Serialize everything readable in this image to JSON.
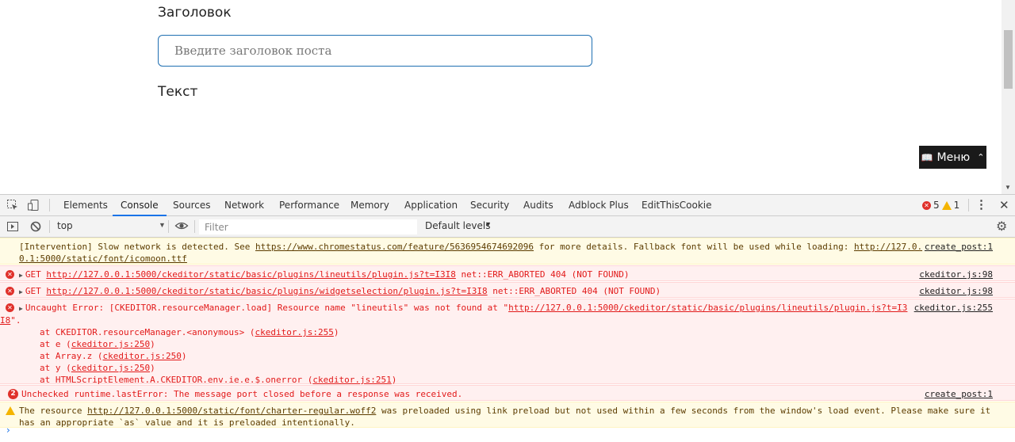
{
  "page": {
    "title_label": "Заголовок",
    "title_placeholder": "Введите заголовок поста",
    "text_label": "Текст",
    "menu_button": "Меню",
    "menu_icon": "book-icon"
  },
  "devtools": {
    "tabs": [
      "Elements",
      "Console",
      "Sources",
      "Network",
      "Performance",
      "Memory",
      "Application",
      "Security",
      "Audits",
      "Adblock Plus",
      "EditThisCookie"
    ],
    "active_tab": "Console",
    "error_count": "5",
    "warning_count": "1",
    "context": "top",
    "filter_placeholder": "Filter",
    "levels": "Default levels"
  },
  "console": {
    "messages": [
      {
        "type": "warning",
        "text_before": "[Intervention] Slow network is detected. See ",
        "link1": "https://www.chromestatus.com/feature/5636954674692096",
        "text_mid": " for more details. Fallback font will be used while loading: ",
        "link2": "http://127.0.",
        "link2_cont": "0.1:5000/static/font/icomoon.ttf",
        "source": "create_post:1"
      },
      {
        "type": "error",
        "method": "GET",
        "url": "http://127.0.0.1:5000/ckeditor/static/basic/plugins/lineutils/plugin.js?t=I3I8",
        "status": " net::ERR_ABORTED 404 (NOT FOUND)",
        "source": "ckeditor.js:98"
      },
      {
        "type": "error",
        "method": "GET",
        "url": "http://127.0.0.1:5000/ckeditor/static/basic/plugins/widgetselection/plugin.js?t=I3I8",
        "status": " net::ERR_ABORTED 404 (NOT FOUND)",
        "source": "ckeditor.js:98"
      },
      {
        "type": "error",
        "text": "Uncaught Error: [CKEDITOR.resourceManager.load] Resource name \"lineutils\" was not found at \"",
        "url": "http://127.0.0.1:5000/ckeditor/static/basic/plugins/lineutils/plugin.js?t=I3",
        "url_cont": "I8",
        "tail": "\".",
        "source": "ckeditor.js:255",
        "stack": [
          {
            "pre": "at CKEDITOR.resourceManager.<anonymous> (",
            "link": "ckeditor.js:255",
            "post": ")"
          },
          {
            "pre": "at e (",
            "link": "ckeditor.js:250",
            "post": ")"
          },
          {
            "pre": "at Array.z (",
            "link": "ckeditor.js:250",
            "post": ")"
          },
          {
            "pre": "at y (",
            "link": "ckeditor.js:250",
            "post": ")"
          },
          {
            "pre": "at HTMLScriptElement.A.CKEDITOR.env.ie.e.$.onerror (",
            "link": "ckeditor.js:251",
            "post": ")"
          }
        ]
      },
      {
        "type": "error",
        "repeat": "2",
        "text": "Unchecked runtime.lastError: The message port closed before a response was received.",
        "source": "create_post:1"
      },
      {
        "type": "warning",
        "text_before": "The resource ",
        "link1": "http://127.0.0.1:5000/static/font/charter-regular.woff2",
        "text_mid": " was preloaded using link preload but not used within a few seconds from the window's load event. Please make sure it",
        "text_cont": "has an appropriate `as` value and it is preloaded intentionally."
      }
    ]
  }
}
